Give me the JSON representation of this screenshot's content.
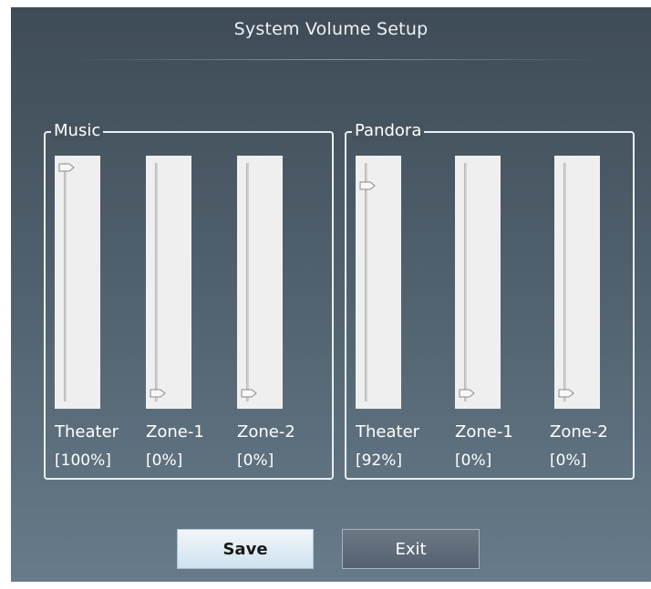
{
  "window": {
    "title": "System Volume Setup"
  },
  "groups": [
    {
      "label": "Music",
      "channels": [
        {
          "name": "Theater",
          "value": "[100%]",
          "level": 1.0
        },
        {
          "name": "Zone-1",
          "value": "[0%]",
          "level": 0.0
        },
        {
          "name": "Zone-2",
          "value": "[0%]",
          "level": 0.0
        }
      ]
    },
    {
      "label": "Pandora",
      "channels": [
        {
          "name": "Theater",
          "value": "[92%]",
          "level": 0.92
        },
        {
          "name": "Zone-1",
          "value": "[0%]",
          "level": 0.0
        },
        {
          "name": "Zone-2",
          "value": "[0%]",
          "level": 0.0
        }
      ]
    }
  ],
  "buttons": {
    "save_label": "Save",
    "exit_label": "Exit"
  }
}
